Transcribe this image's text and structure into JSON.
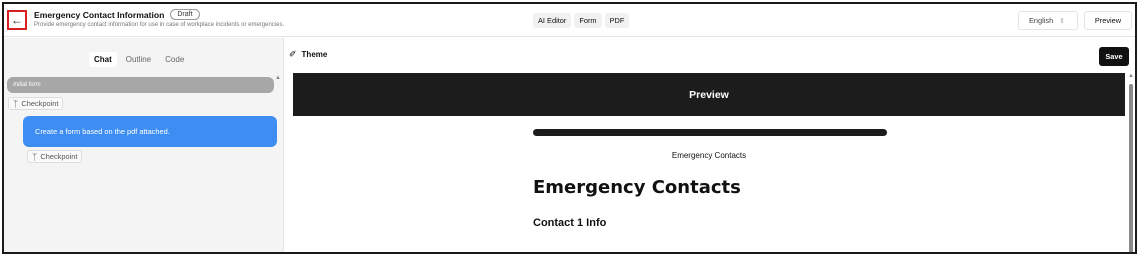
{
  "header": {
    "back_icon": "arrow-left-icon",
    "title": "Emergency Contact Information",
    "badge": "Draft",
    "subtitle": "Provide emergency contact information for use in case of workplace incidents or emergencies.",
    "mode_tabs": [
      "AI Editor",
      "Form",
      "PDF"
    ],
    "language": "English",
    "preview_label": "Preview"
  },
  "left_panel": {
    "tabs": [
      "Chat",
      "Outline",
      "Code"
    ],
    "active_tab": "Chat",
    "initial_label": "Initial form",
    "checkpoint_label": "Checkpoint",
    "user_message": "Create a form based on the pdf attached.",
    "checkpoint_label_2": "Checkpoint"
  },
  "right_panel": {
    "theme_label": "Theme",
    "save_label": "Save",
    "preview": {
      "header": "Preview",
      "caption": "Emergency Contacts",
      "heading": "Emergency Contacts",
      "section": "Contact 1 Info"
    }
  },
  "colors": {
    "accent_blue": "#3e8df3",
    "dark": "#1c1c1c",
    "highlight_red": "#d61f1f"
  }
}
